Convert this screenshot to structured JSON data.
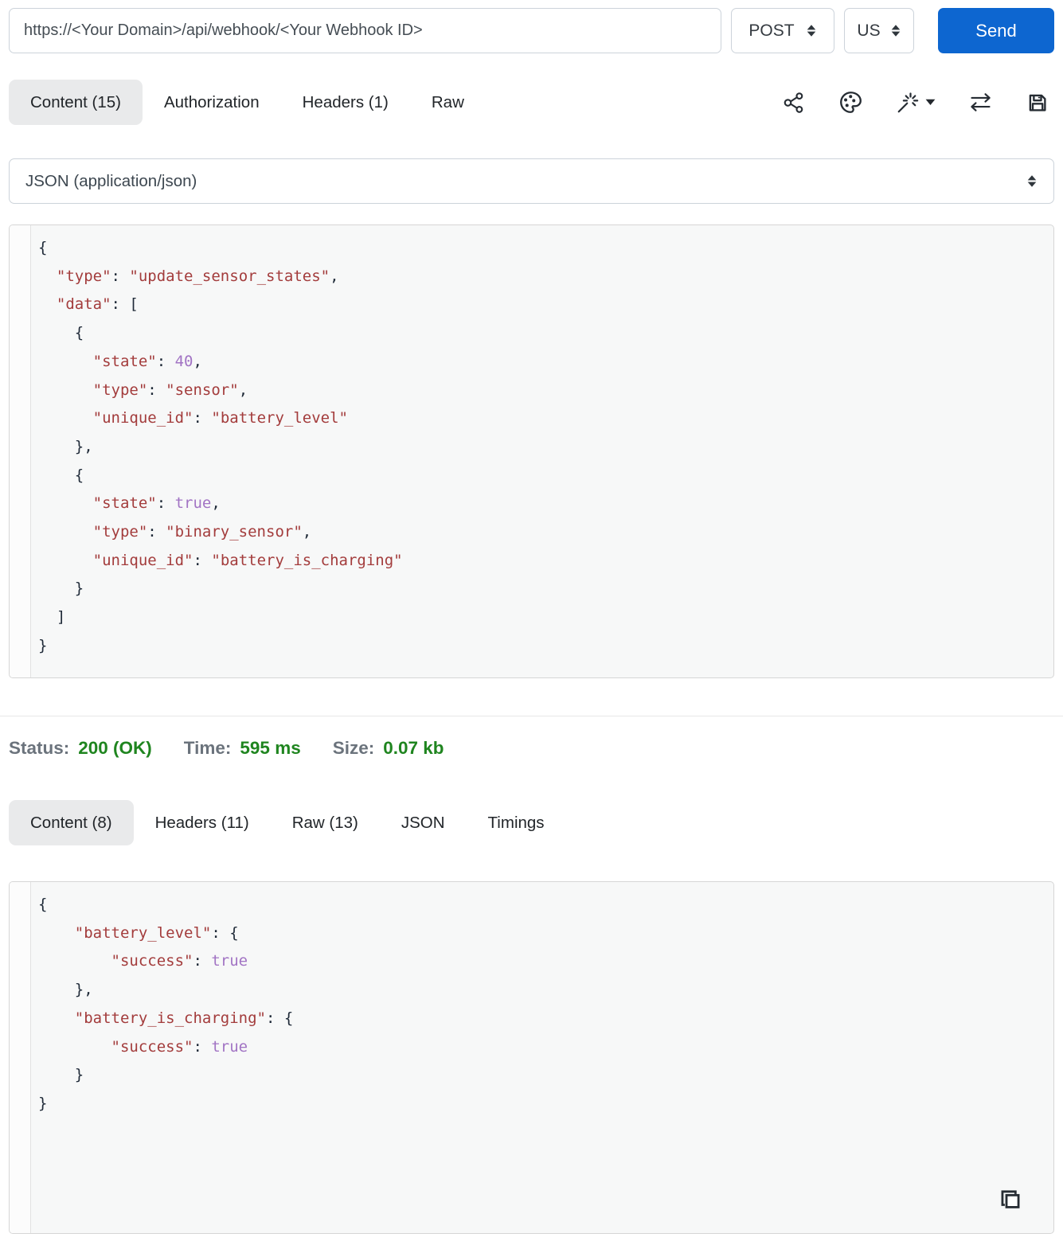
{
  "request_bar": {
    "url": "https://<Your Domain>/api/webhook/<Your Webhook ID>",
    "method": "POST",
    "region": "US",
    "send_label": "Send"
  },
  "request_tabs": [
    {
      "label": "Content (15)",
      "active": true
    },
    {
      "label": "Authorization",
      "active": false
    },
    {
      "label": "Headers (1)",
      "active": false
    },
    {
      "label": "Raw",
      "active": false
    }
  ],
  "toolbar": {
    "icons": [
      "share-icon",
      "palette-icon",
      "magic-wand-icon",
      "swap-arrows-icon",
      "save-icon"
    ]
  },
  "content_type": {
    "selected": "JSON (application/json)"
  },
  "request_body": {
    "lines": [
      [
        [
          "p",
          "{"
        ]
      ],
      [
        [
          "w",
          "  "
        ],
        [
          "s",
          "\"type\""
        ],
        [
          "p",
          ": "
        ],
        [
          "s",
          "\"update_sensor_states\""
        ],
        [
          "p",
          ","
        ]
      ],
      [
        [
          "w",
          "  "
        ],
        [
          "s",
          "\"data\""
        ],
        [
          "p",
          ": ["
        ]
      ],
      [
        [
          "w",
          "    "
        ],
        [
          "p",
          "{"
        ]
      ],
      [
        [
          "w",
          "      "
        ],
        [
          "s",
          "\"state\""
        ],
        [
          "p",
          ": "
        ],
        [
          "a",
          "40"
        ],
        [
          "p",
          ","
        ]
      ],
      [
        [
          "w",
          "      "
        ],
        [
          "s",
          "\"type\""
        ],
        [
          "p",
          ": "
        ],
        [
          "s",
          "\"sensor\""
        ],
        [
          "p",
          ","
        ]
      ],
      [
        [
          "w",
          "      "
        ],
        [
          "s",
          "\"unique_id\""
        ],
        [
          "p",
          ": "
        ],
        [
          "s",
          "\"battery_level\""
        ]
      ],
      [
        [
          "w",
          "    "
        ],
        [
          "p",
          "},"
        ]
      ],
      [
        [
          "w",
          "    "
        ],
        [
          "p",
          "{"
        ]
      ],
      [
        [
          "w",
          "      "
        ],
        [
          "s",
          "\"state\""
        ],
        [
          "p",
          ": "
        ],
        [
          "a",
          "true"
        ],
        [
          "p",
          ","
        ]
      ],
      [
        [
          "w",
          "      "
        ],
        [
          "s",
          "\"type\""
        ],
        [
          "p",
          ": "
        ],
        [
          "s",
          "\"binary_sensor\""
        ],
        [
          "p",
          ","
        ]
      ],
      [
        [
          "w",
          "      "
        ],
        [
          "s",
          "\"unique_id\""
        ],
        [
          "p",
          ": "
        ],
        [
          "s",
          "\"battery_is_charging\""
        ]
      ],
      [
        [
          "w",
          "    "
        ],
        [
          "p",
          "}"
        ]
      ],
      [
        [
          "w",
          "  "
        ],
        [
          "p",
          "]"
        ]
      ],
      [
        [
          "p",
          "}"
        ]
      ]
    ]
  },
  "status_bar": {
    "status_label": "Status:",
    "status_value": "200 (OK)",
    "time_label": "Time:",
    "time_value": "595 ms",
    "size_label": "Size:",
    "size_value": "0.07 kb"
  },
  "response_tabs": [
    {
      "label": "Content (8)",
      "active": true
    },
    {
      "label": "Headers (11)",
      "active": false
    },
    {
      "label": "Raw (13)",
      "active": false
    },
    {
      "label": "JSON",
      "active": false
    },
    {
      "label": "Timings",
      "active": false
    }
  ],
  "response_body": {
    "lines": [
      [
        [
          "p",
          "{"
        ]
      ],
      [
        [
          "w",
          "    "
        ],
        [
          "s",
          "\"battery_level\""
        ],
        [
          "p",
          ": {"
        ]
      ],
      [
        [
          "w",
          "        "
        ],
        [
          "s",
          "\"success\""
        ],
        [
          "p",
          ": "
        ],
        [
          "a",
          "true"
        ]
      ],
      [
        [
          "w",
          "    "
        ],
        [
          "p",
          "},"
        ]
      ],
      [
        [
          "w",
          "    "
        ],
        [
          "s",
          "\"battery_is_charging\""
        ],
        [
          "p",
          ": {"
        ]
      ],
      [
        [
          "w",
          "        "
        ],
        [
          "s",
          "\"success\""
        ],
        [
          "p",
          ": "
        ],
        [
          "a",
          "true"
        ]
      ],
      [
        [
          "w",
          "    "
        ],
        [
          "p",
          "}"
        ]
      ],
      [
        [
          "p",
          "}"
        ]
      ]
    ]
  },
  "colors": {
    "accent": "#0d66d0",
    "status-green": "#1f851f",
    "code-string": "#a33c3c",
    "code-atom": "#a274c4",
    "tab-active-bg": "#e9eaeb"
  }
}
